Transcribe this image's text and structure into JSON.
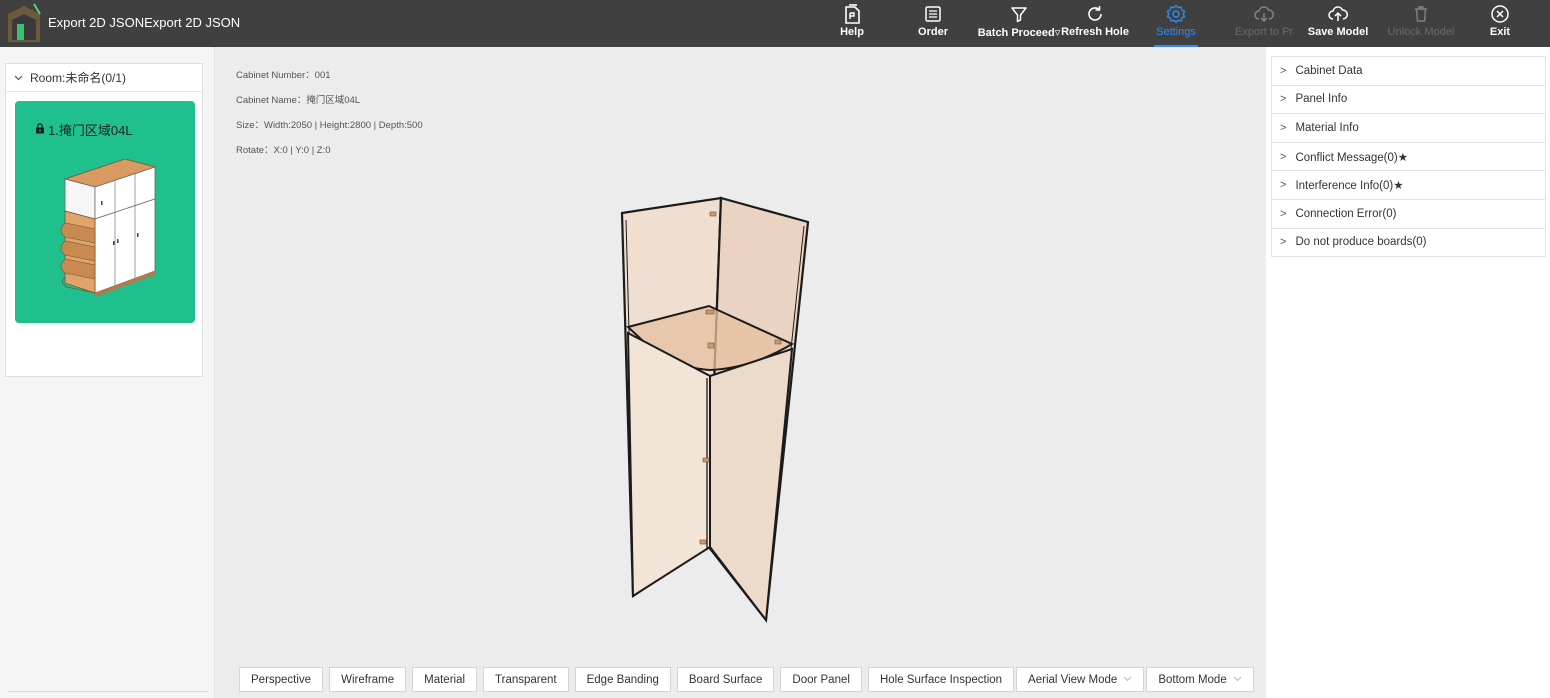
{
  "app": {
    "title": "Export 2D JSONExport 2D JSON"
  },
  "toolbar": {
    "help": "Help",
    "order": "Order",
    "batch_proceed": "Batch Proceed▿",
    "refresh_hole": "Refresh Hole",
    "settings": "Settings",
    "export_to_produce": "Export to Produce",
    "save_model": "Save Model",
    "unlock_model": "Unlock Model",
    "exit": "Exit"
  },
  "room": {
    "label": "Room:未命名(0/1)",
    "cabinet_card_title": "1.掩门区域04L"
  },
  "cabinet_info": {
    "number": "Cabinet Number：001",
    "name": "Cabinet Name：掩门区域04L",
    "size": "Size：Width:2050 | Height:2800 | Depth:500",
    "rotate": "Rotate：X:0 | Y:0 | Z:0"
  },
  "view_buttons": {
    "perspective": "Perspective",
    "wireframe": "Wireframe",
    "material": "Material",
    "transparent": "Transparent",
    "edge_banding": "Edge Banding",
    "board_surface": "Board Surface",
    "door_panel": "Door Panel",
    "hole_surface_inspection": "Hole Surface Inspection",
    "aerial_view_mode": "Aerial View Mode",
    "bottom_mode": "Bottom Mode"
  },
  "right_panel": {
    "items": [
      {
        "label": "Cabinet Data"
      },
      {
        "label": "Panel Info"
      },
      {
        "label": "Material Info"
      },
      {
        "label": "Conflict Message(0)★"
      },
      {
        "label": "Interference Info(0)★"
      },
      {
        "label": "Connection Error(0)"
      },
      {
        "label": "Do not produce boards(0)"
      }
    ]
  },
  "colors": {
    "topbar": "#404040",
    "accent": "#2f8cf0",
    "card": "#1fbf8e",
    "panel_wood": "#f0ded0"
  }
}
